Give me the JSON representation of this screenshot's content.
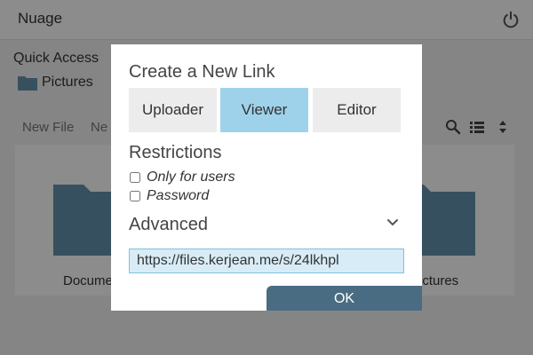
{
  "app": {
    "title": "Nuage",
    "quick_access": {
      "label": "Quick Access",
      "items": [
        {
          "label": "Pictures",
          "icon": "folder-icon"
        }
      ]
    },
    "toolbar": {
      "new_file": "New File",
      "new_folder_partial": "Ne",
      "icons": [
        "search-icon",
        "list-view-icon",
        "sort-icon"
      ]
    },
    "tiles": [
      {
        "label": "Docume",
        "icon": "folder-icon"
      },
      {
        "label": "ictures",
        "icon": "folder-icon"
      }
    ],
    "colors": {
      "folder": "#6593ae",
      "topbar": "#ffffff"
    }
  },
  "modal": {
    "title": "Create a New Link",
    "roles": [
      {
        "label": "Uploader",
        "active": false
      },
      {
        "label": "Viewer",
        "active": true
      },
      {
        "label": "Editor",
        "active": false
      }
    ],
    "restrictions": {
      "title": "Restrictions",
      "options": [
        {
          "label": "Only for users",
          "checked": false
        },
        {
          "label": "Password",
          "checked": false
        }
      ]
    },
    "advanced": {
      "label": "Advanced",
      "icon": "chevron-down-icon"
    },
    "link_value": "https://files.kerjean.me/s/24lkhpl",
    "ok_label": "OK",
    "colors": {
      "active_role": "#9ed2ea",
      "ok_button": "#4a6c82",
      "link_bg": "#d7ecf6"
    }
  }
}
